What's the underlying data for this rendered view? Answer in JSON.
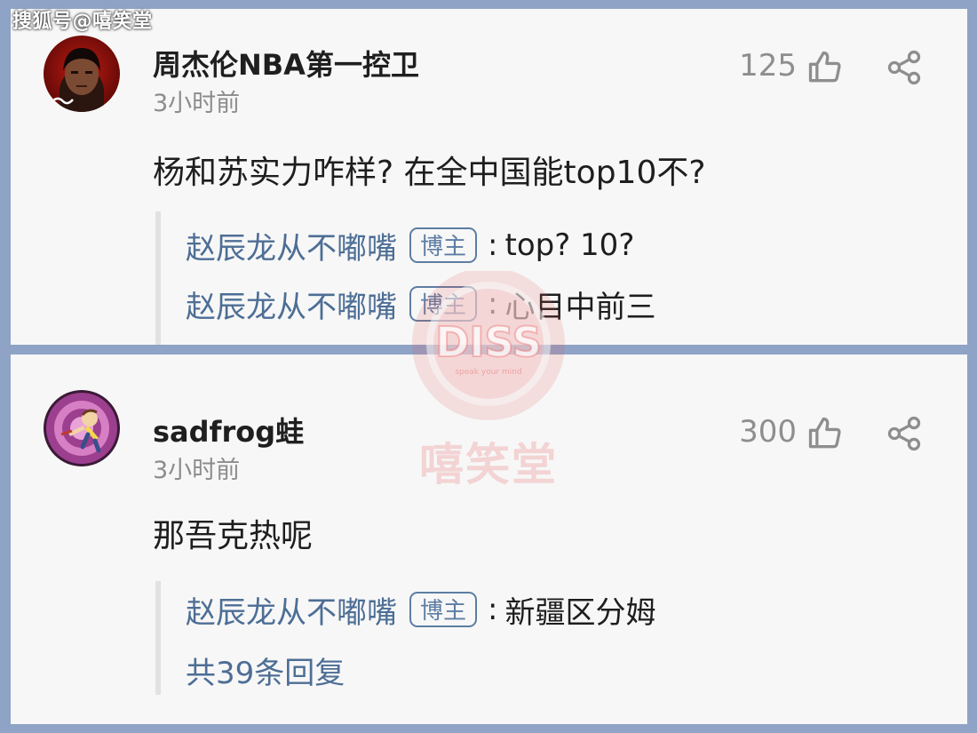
{
  "source_banner": "搜狐号@嘻笑堂",
  "comments": [
    {
      "username": "周杰伦NBA第一控卫",
      "timestamp": "3小时前",
      "likes": "125",
      "body": "杨和苏实力咋样? 在全中国能top10不?",
      "replies": [
        {
          "author": "赵辰龙从不嘟嘴",
          "badge": "博主",
          "separator": ":",
          "text": "top? 10?"
        },
        {
          "author": "赵辰龙从不嘟嘴",
          "badge": "博主",
          "separator": ":",
          "text": "心目中前三"
        }
      ]
    },
    {
      "username": "sadfrog蛙",
      "timestamp": "3小时前",
      "likes": "300",
      "body": "那吾克热呢",
      "replies": [
        {
          "author": "赵辰龙从不嘟嘴",
          "badge": "博主",
          "separator": ":",
          "text": "新疆区分姆"
        }
      ],
      "more_replies": "共39条回复"
    }
  ],
  "watermark": {
    "logo_text": "DISS",
    "logo_subtext": "speak your mind",
    "label": "嘻笑堂"
  },
  "icons": {
    "like": "thumbs-up-icon",
    "share": "share-icon"
  },
  "colors": {
    "link": "#4d6e95",
    "badge": "#5d7da3",
    "meta": "#8c8c8c",
    "watermark": "#e85656"
  }
}
